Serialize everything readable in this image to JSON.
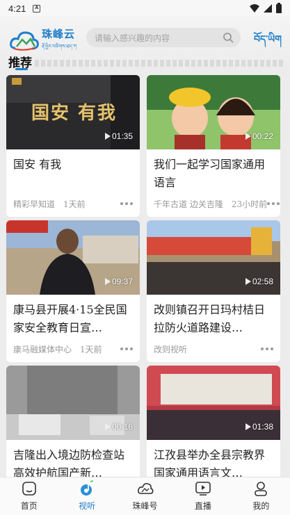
{
  "status_bar": {
    "time": "4:21",
    "notification": "A"
  },
  "header": {
    "logo_cn": "珠峰云",
    "logo_tibetan": "རྡོ་ཕྱིར་བཅིགས་ཐད་ཀ",
    "search_placeholder": "请输入感兴趣的内容",
    "lang_button": "བོད་ཡིག",
    "section_title": "推荐"
  },
  "cards": [
    {
      "title": "国安 有我",
      "source": "精彩早知道",
      "time": "1天前",
      "duration": "01:35",
      "thumb_text": "国安 有我"
    },
    {
      "title": "我们一起学习国家通用语言",
      "source": "千年古道 边关吉隆",
      "time": "23小时前",
      "duration": "00:22"
    },
    {
      "title": "康马县开展4·15全民国家安全教育日宣…",
      "source": "康马融媒体中心",
      "time": "1天前",
      "duration": "09:37"
    },
    {
      "title": "改则镇召开日玛村桔日拉防火道路建设…",
      "source": "改则视听",
      "time": "",
      "duration": "02:58"
    },
    {
      "title": "吉隆出入境边防检查站高效护航国产新…",
      "source": "",
      "time": "",
      "duration": "00:16"
    },
    {
      "title": "江孜县举办全县宗教界国家通用语言文…",
      "source": "",
      "time": "",
      "duration": "01:38"
    }
  ],
  "nav": [
    {
      "label": "首页",
      "icon": "home-icon",
      "active": false
    },
    {
      "label": "视听",
      "icon": "music-note-icon",
      "active": true
    },
    {
      "label": "珠峰号",
      "icon": "cloud-icon",
      "active": false
    },
    {
      "label": "直播",
      "icon": "live-play-icon",
      "active": false
    },
    {
      "label": "我的",
      "icon": "profile-icon",
      "active": false
    }
  ],
  "colors": {
    "accent": "#1f7ec8",
    "background": "#ececec"
  }
}
